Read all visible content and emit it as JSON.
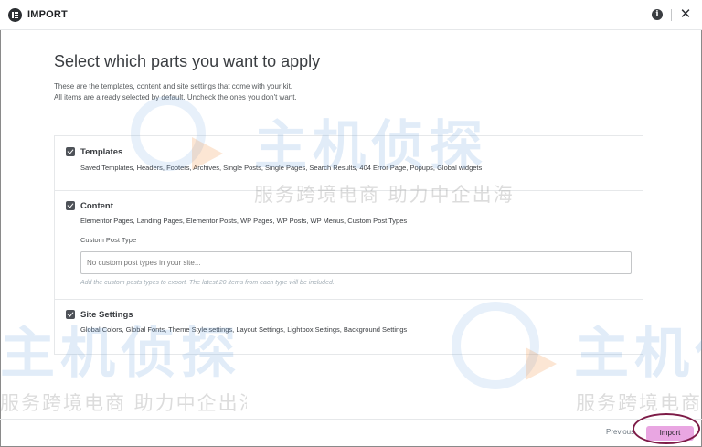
{
  "header": {
    "title": "IMPORT",
    "info_glyph": "i",
    "close_glyph": "✕"
  },
  "main": {
    "title": "Select which parts you want to apply",
    "desc_line1": "These are the templates, content and site settings that come with your kit.",
    "desc_line2": "All items are already selected by default. Uncheck the ones you don't want."
  },
  "sections": [
    {
      "title": "Templates",
      "items": "Saved Templates, Headers, Footers, Archives, Single Posts, Single Pages, Search Results, 404 Error Page, Popups, Global widgets",
      "checked": true
    },
    {
      "title": "Content",
      "items": "Elementor Pages, Landing Pages, Elementor Posts, WP Pages, WP Posts, WP Menus, Custom Post Types",
      "checked": true,
      "cpt_label": "Custom Post Type",
      "cpt_placeholder": "No custom post types in your site...",
      "cpt_hint": "Add the custom posts types to export. The latest 20 items from each type will be included."
    },
    {
      "title": "Site Settings",
      "items": "Global Colors, Global Fonts, Theme Style settings, Layout Settings, Lightbox Settings, Background Settings",
      "checked": true
    }
  ],
  "footer": {
    "previous_label": "Previous",
    "import_label": "Import"
  },
  "watermark": {
    "brand": "主机侦探",
    "slogan": "服务跨境电商 助力中企出海"
  },
  "colors": {
    "import_button": "#e9a6e2",
    "highlight_ring": "#7d1b47",
    "checkbox": "#4e5258"
  }
}
